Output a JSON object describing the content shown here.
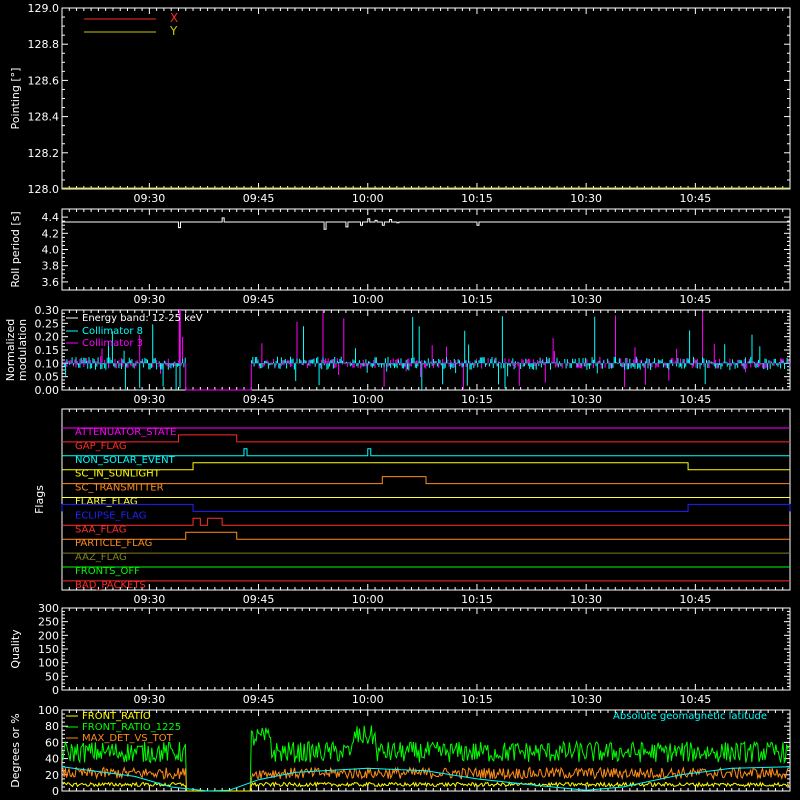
{
  "colors": {
    "background": "#000000",
    "axes": "#ffffff",
    "x_series": "#ff2a2a",
    "y_series": "#c8c800",
    "roll": "#ffffff",
    "energy": "#ffffff",
    "coll8": "#00ffff",
    "coll3": "#ff00ff",
    "attenuator": "#ff00ff",
    "gap": "#ff2a2a",
    "non_solar": "#00ffff",
    "sunlight": "#ffff00",
    "transmitter": "#ff8c1a",
    "flare": "#ffff33",
    "eclipse": "#2020ff",
    "saa": "#ff3030",
    "particle": "#ff8c1a",
    "aaz": "#808020",
    "fronts_off": "#00ff00",
    "bad_packets": "#ff2a2a",
    "front_ratio": "#ffff00",
    "front_ratio_1225": "#00ff00",
    "max_det": "#ff8c1a",
    "geomag": "#00ffff"
  },
  "time_axis": {
    "tmin": "09:18",
    "tmax": "10:58",
    "tick_labels": [
      "09:30",
      "09:45",
      "10:00",
      "10:15",
      "10:30",
      "10:45"
    ]
  },
  "chart_data": [
    {
      "type": "line",
      "id": "pointing",
      "ylabel": "Pointing [°]",
      "ylim": [
        128.0,
        129.0
      ],
      "y_ticks": [
        "128.0",
        "128.2",
        "128.4",
        "128.6",
        "128.8",
        "129.0"
      ],
      "series": [
        {
          "name": "X",
          "x": [
            "09:18",
            "10:58"
          ],
          "values": [
            128.0,
            128.0
          ]
        },
        {
          "name": "Y",
          "x": [
            "09:18",
            "10:58"
          ],
          "values": [
            128.0,
            128.0
          ]
        }
      ]
    },
    {
      "type": "line",
      "id": "roll",
      "ylabel": "Roll period [s]",
      "ylim": [
        3.5,
        4.5
      ],
      "y_ticks": [
        "3.6",
        "3.8",
        "4.0",
        "4.2",
        "4.4"
      ],
      "series": [
        {
          "values_base": 4.34,
          "dips": [
            [
              "09:34",
              4.27
            ],
            [
              "09:40",
              4.39
            ],
            [
              "09:54",
              4.25
            ],
            [
              "09:57",
              4.28
            ],
            [
              "09:59",
              4.3
            ],
            [
              "10:00",
              4.38
            ],
            [
              "10:01",
              4.36
            ],
            [
              "10:02",
              4.3
            ],
            [
              "10:03",
              4.37
            ],
            [
              "10:04",
              4.33
            ],
            [
              "10:15",
              4.3
            ]
          ]
        }
      ]
    },
    {
      "type": "line",
      "id": "modulation",
      "ylabel": "Normalized modulation",
      "ylim": [
        0.0,
        0.3
      ],
      "y_ticks": [
        "0.00",
        "0.05",
        "0.10",
        "0.15",
        "0.20",
        "0.25",
        "0.30"
      ],
      "legend": [
        "Energy band: 12-25 keV",
        "Collimator 8",
        "Collimator 3"
      ],
      "baseline": 0.1,
      "gaps": [
        [
          "09:35",
          "09:44"
        ]
      ],
      "series": [
        {
          "name": "Collimator 8",
          "values_note": "noisy around 0.1"
        },
        {
          "name": "Collimator 3",
          "values_note": "noisy around 0.1"
        }
      ]
    },
    {
      "type": "line",
      "id": "flags",
      "ylabel": "Flags",
      "flags": [
        {
          "name": "ATTENUATOR_STATE",
          "color": "attenuator",
          "on": []
        },
        {
          "name": "GAP_FLAG",
          "color": "gap",
          "on": [
            [
              "09:34",
              "09:42"
            ]
          ]
        },
        {
          "name": "NON_SOLAR_EVENT",
          "color": "non_solar",
          "on": [
            [
              "09:43",
              "09:43"
            ],
            [
              "10:00",
              "10:00"
            ]
          ]
        },
        {
          "name": "SC_IN_SUNLIGHT",
          "color": "sunlight",
          "on": [
            [
              "09:36",
              "10:44"
            ]
          ]
        },
        {
          "name": "SC_TRANSMITTER",
          "color": "transmitter",
          "on": [
            [
              "10:02",
              "10:08"
            ]
          ]
        },
        {
          "name": "FLARE_FLAG",
          "color": "flare",
          "on": []
        },
        {
          "name": "ECLIPSE_FLAG",
          "color": "eclipse",
          "on": [
            [
              "09:18",
              "09:36"
            ],
            [
              "10:44",
              "10:58"
            ]
          ]
        },
        {
          "name": "SAA_FLAG",
          "color": "saa",
          "on": [
            [
              "09:36",
              "09:37"
            ],
            [
              "09:38",
              "09:40"
            ]
          ]
        },
        {
          "name": "PARTICLE_FLAG",
          "color": "particle",
          "on": [
            [
              "09:35",
              "09:42"
            ]
          ]
        },
        {
          "name": "AAZ_FLAG",
          "color": "aaz",
          "on": []
        },
        {
          "name": "FRONTS_OFF",
          "color": "fronts_off",
          "on": []
        },
        {
          "name": "BAD_PACKETS",
          "color": "bad_packets",
          "on": []
        }
      ]
    },
    {
      "type": "line",
      "id": "quality",
      "ylabel": "Quality",
      "ylim": [
        0,
        300
      ],
      "y_ticks": [
        "0",
        "50",
        "100",
        "150",
        "200",
        "250",
        "300"
      ],
      "series": []
    },
    {
      "type": "line",
      "id": "ratios",
      "ylabel": "Degrees or %",
      "ylim": [
        0,
        100
      ],
      "y_ticks": [
        "0",
        "20",
        "40",
        "60",
        "80",
        "100"
      ],
      "legend": [
        "FRONT_RATIO",
        "FRONT_RATIO_1225",
        "MAX_DET_VS_TOT"
      ],
      "right_legend": "Absolute geomagnetic latitude",
      "series": [
        {
          "name": "FRONT_RATIO",
          "level": 8
        },
        {
          "name": "FRONT_RATIO_1225",
          "level": 48
        },
        {
          "name": "MAX_DET_VS_TOT",
          "level": 22
        },
        {
          "name": "Absolute geomagnetic latitude",
          "points": [
            [
              "09:18",
              30
            ],
            [
              "09:28",
              18
            ],
            [
              "09:33",
              5
            ],
            [
              "09:38",
              0
            ],
            [
              "09:41",
              1
            ],
            [
              "09:45",
              14
            ],
            [
              "09:50",
              23
            ],
            [
              "10:00",
              28
            ],
            [
              "10:08",
              25
            ],
            [
              "10:15",
              15
            ],
            [
              "10:22",
              8
            ],
            [
              "10:30",
              1
            ],
            [
              "10:35",
              5
            ],
            [
              "10:43",
              20
            ],
            [
              "10:50",
              28
            ],
            [
              "10:58",
              30
            ]
          ]
        }
      ]
    }
  ]
}
